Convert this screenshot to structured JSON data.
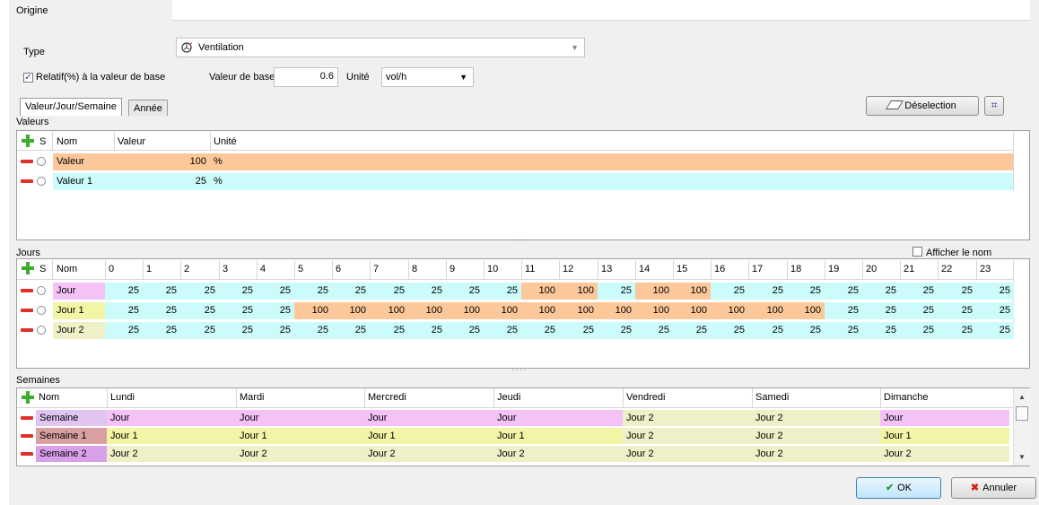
{
  "origine_label": "Origine",
  "type_label": "Type",
  "type_value": "Ventilation",
  "relatif_label": "Relatif(%) à la valeur de base",
  "relatif_checked": true,
  "valeur_base_label": "Valeur de base",
  "valeur_base_value": "0.6",
  "unite_label": "Unité",
  "unite_value": "vol/h",
  "tabs": [
    "Valeur/Jour/Semaine",
    "Année"
  ],
  "deselection_label": "Déselection",
  "valeurs": {
    "title": "Valeurs",
    "headers": {
      "s": "S",
      "nom": "Nom",
      "valeur": "Valeur",
      "unite": "Unité"
    },
    "rows": [
      {
        "nom": "Valeur",
        "valeur": "100",
        "unite": "%",
        "color": "#fcc89a"
      },
      {
        "nom": "Valeur 1",
        "valeur": "25",
        "unite": "%",
        "color": "#ccfbfb"
      }
    ]
  },
  "jours": {
    "title": "Jours",
    "afficher_label": "Afficher le nom",
    "headers": {
      "s": "S",
      "nom": "Nom"
    },
    "hours": [
      "0",
      "1",
      "2",
      "3",
      "4",
      "5",
      "6",
      "7",
      "8",
      "9",
      "10",
      "11",
      "12",
      "13",
      "14",
      "15",
      "16",
      "17",
      "18",
      "19",
      "20",
      "21",
      "22",
      "23"
    ],
    "rows": [
      {
        "nom": "Jour",
        "color": "#f4c2f7",
        "values": [
          "25",
          "25",
          "25",
          "25",
          "25",
          "25",
          "25",
          "25",
          "25",
          "25",
          "25",
          "100",
          "100",
          "25",
          "100",
          "100",
          "25",
          "25",
          "25",
          "25",
          "25",
          "25",
          "25",
          "25"
        ]
      },
      {
        "nom": "Jour 1",
        "color": "#f2f4a6",
        "values": [
          "25",
          "25",
          "25",
          "25",
          "25",
          "100",
          "100",
          "100",
          "100",
          "100",
          "100",
          "100",
          "100",
          "100",
          "100",
          "100",
          "100",
          "100",
          "100",
          "25",
          "25",
          "25",
          "25",
          "25"
        ]
      },
      {
        "nom": "Jour 2",
        "color": "#f0f0c8",
        "values": [
          "25",
          "25",
          "25",
          "25",
          "25",
          "25",
          "25",
          "25",
          "25",
          "25",
          "25",
          "25",
          "25",
          "25",
          "25",
          "25",
          "25",
          "25",
          "25",
          "25",
          "25",
          "25",
          "25",
          "25"
        ]
      }
    ]
  },
  "semaines": {
    "title": "Semaines",
    "headers": {
      "nom": "Nom",
      "days": [
        "Lundi",
        "Mardi",
        "Mercredi",
        "Jeudi",
        "Vendredi",
        "Samedi",
        "Dimanche"
      ]
    },
    "rows": [
      {
        "nom": "Semaine",
        "color": "#e0c4f2",
        "days": [
          "Jour",
          "Jour",
          "Jour",
          "Jour",
          "Jour 2",
          "Jour 2",
          "Jour"
        ]
      },
      {
        "nom": "Semaine 1",
        "color": "#d8a0a0",
        "days": [
          "Jour 1",
          "Jour 1",
          "Jour 1",
          "Jour 1",
          "Jour 2",
          "Jour 2",
          "Jour 1"
        ]
      },
      {
        "nom": "Semaine 2",
        "color": "#d9a0ea",
        "days": [
          "Jour 2",
          "Jour 2",
          "Jour 2",
          "Jour 2",
          "Jour 2",
          "Jour 2",
          "Jour 2"
        ]
      }
    ]
  },
  "colors": {
    "orange": "#fcc89a",
    "cyan": "#ccfbfb",
    "pink": "#f4c2f7",
    "yellow": "#f2f4a6",
    "khaki": "#f0f0c8"
  },
  "ok_label": "OK",
  "annuler_label": "Annuler"
}
